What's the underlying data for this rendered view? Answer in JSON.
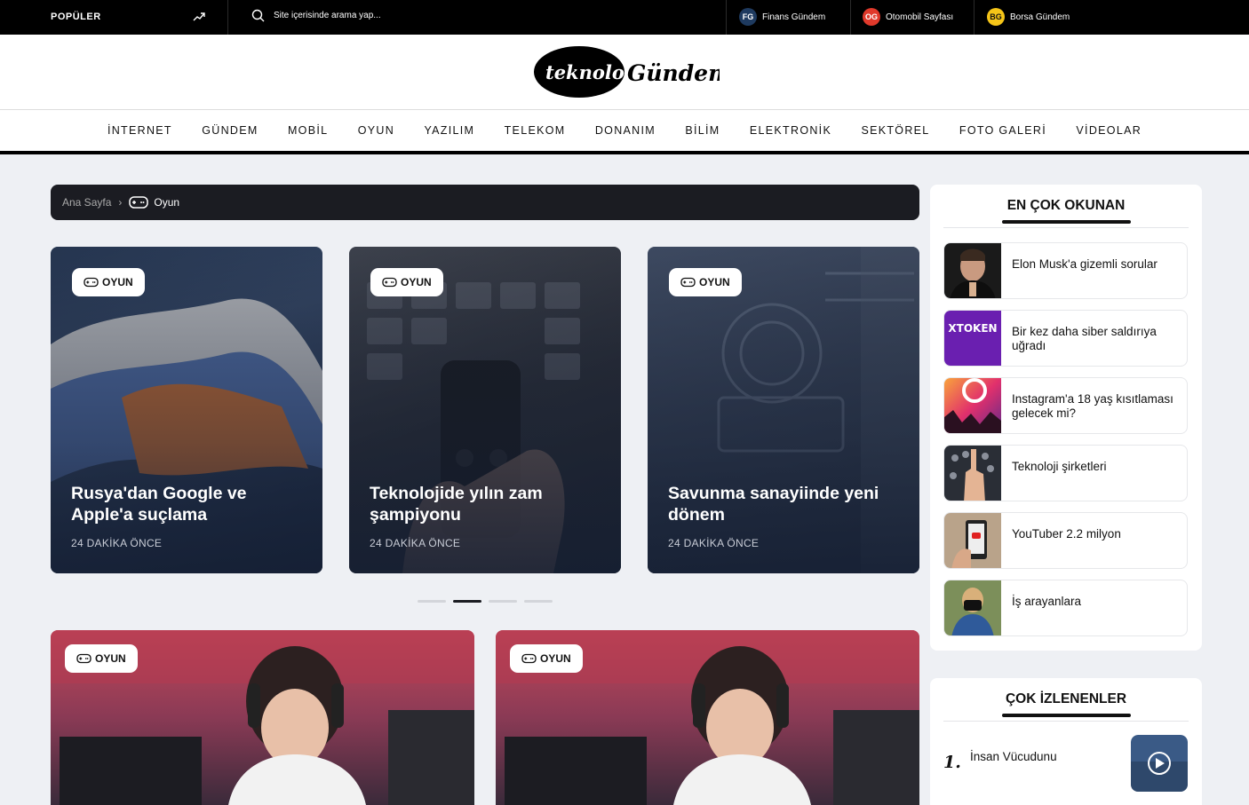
{
  "topbar": {
    "popular": "POPÜLER",
    "search_placeholder": "Site içerisinde arama yap...",
    "links": [
      {
        "badge": "FG",
        "label": "Finans Gündem",
        "color": "#1e3a5f"
      },
      {
        "badge": "OG",
        "label": "Otomobil Sayfası",
        "color": "#e0392b"
      },
      {
        "badge": "BG",
        "label": "Borsa Gündem",
        "color": "#f5c518"
      }
    ]
  },
  "logo": {
    "part1": "teknoloji",
    "part2": "Gündem"
  },
  "nav": [
    "İNTERNET",
    "GÜNDEM",
    "MOBİL",
    "OYUN",
    "YAZILIM",
    "TELEKOM",
    "DONANIM",
    "BİLİM",
    "ELEKTRONİK",
    "SEKTÖREL",
    "FOTO GALERİ",
    "VİDEOLAR"
  ],
  "breadcrumb": {
    "home": "Ana Sayfa",
    "current": "Oyun"
  },
  "slider": [
    {
      "category": "OYUN",
      "title": "Rusya'dan Google ve Apple'a suçlama",
      "time": "24 DAKİKA ÖNCE"
    },
    {
      "category": "OYUN",
      "title": "Teknolojide yılın zam şampiyonu",
      "time": "24 DAKİKA ÖNCE"
    },
    {
      "category": "OYUN",
      "title": "Savunma sanayiinde yeni dönem",
      "time": "24 DAKİKA ÖNCE"
    }
  ],
  "slider_active_index": 1,
  "big_cards": [
    {
      "category": "OYUN"
    },
    {
      "category": "OYUN"
    }
  ],
  "most_read": {
    "title": "EN ÇOK OKUNAN",
    "items": [
      "Elon Musk'a gizemli sorular",
      "Bir kez daha siber saldırıya uğradı",
      "Instagram'a 18 yaş kısıtlaması gelecek mi?",
      "Teknoloji şirketleri",
      "YouTuber 2.2 milyon",
      "İş arayanlara"
    ]
  },
  "most_watched": {
    "title": "ÇOK İZLENENLER",
    "items": [
      {
        "rank": "1.",
        "title": "İnsan Vücudunu"
      }
    ]
  },
  "thumb_text": "XTOKEN"
}
